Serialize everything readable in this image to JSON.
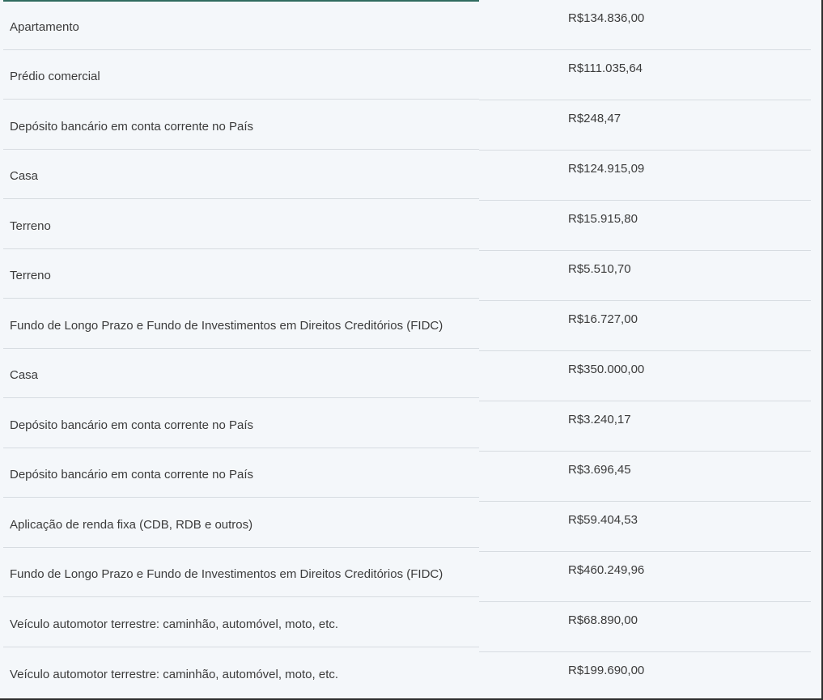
{
  "rows": [
    {
      "description": "Apartamento",
      "value": "R$134.836,00"
    },
    {
      "description": "Prédio comercial",
      "value": "R$111.035,64"
    },
    {
      "description": "Depósito bancário em conta corrente no País",
      "value": "R$248,47"
    },
    {
      "description": "Casa",
      "value": "R$124.915,09"
    },
    {
      "description": "Terreno",
      "value": "R$15.915,80"
    },
    {
      "description": "Terreno",
      "value": "R$5.510,70"
    },
    {
      "description": "Fundo de Longo Prazo e Fundo de Investimentos em Direitos Creditórios (FIDC)",
      "value": "R$16.727,00"
    },
    {
      "description": "Casa",
      "value": "R$350.000,00"
    },
    {
      "description": "Depósito bancário em conta corrente no País",
      "value": "R$3.240,17"
    },
    {
      "description": "Depósito bancário em conta corrente no País",
      "value": "R$3.696,45"
    },
    {
      "description": "Aplicação de renda fixa (CDB, RDB e outros)",
      "value": "R$59.404,53"
    },
    {
      "description": "Fundo de Longo Prazo e Fundo de Investimentos em Direitos Creditórios (FIDC)",
      "value": "R$460.249,96"
    },
    {
      "description": "Veículo automotor terrestre: caminhão, automóvel, moto, etc.",
      "value": "R$68.890,00"
    },
    {
      "description": "Veículo automotor terrestre: caminhão, automóvel, moto, etc.",
      "value": "R$199.690,00"
    }
  ],
  "colors": {
    "background": "#f4f7fa",
    "text": "#3b3b3b",
    "divider": "#d7dce1",
    "accent": "#2f6b5f"
  }
}
